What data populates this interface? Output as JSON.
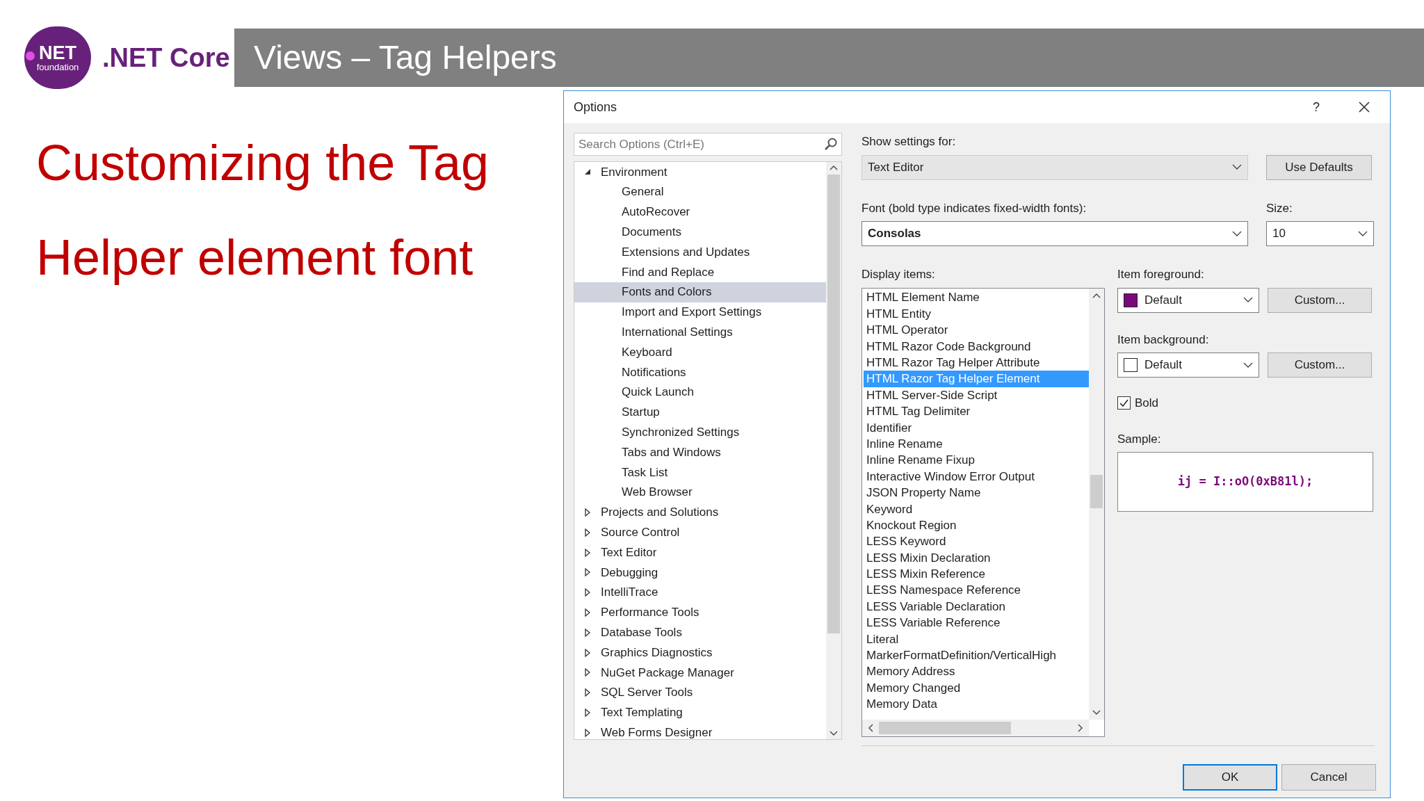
{
  "header": {
    "logo_top": "NET",
    "logo_bottom": "foundation",
    "brand": ".NET Core",
    "title": "Views – Tag Helpers"
  },
  "heading_lines": [
    "Customizing the Tag",
    "Helper element font"
  ],
  "dialog": {
    "title": "Options",
    "help": "?",
    "search": {
      "placeholder": "Search Options (Ctrl+E)"
    },
    "tree": [
      {
        "label": "Environment",
        "expanded": true,
        "children": [
          {
            "label": "General",
            "selected": false
          },
          {
            "label": "AutoRecover",
            "selected": false
          },
          {
            "label": "Documents",
            "selected": false
          },
          {
            "label": "Extensions and Updates",
            "selected": false
          },
          {
            "label": "Find and Replace",
            "selected": false
          },
          {
            "label": "Fonts and Colors",
            "selected": true
          },
          {
            "label": "Import and Export Settings",
            "selected": false
          },
          {
            "label": "International Settings",
            "selected": false
          },
          {
            "label": "Keyboard",
            "selected": false
          },
          {
            "label": "Notifications",
            "selected": false
          },
          {
            "label": "Quick Launch",
            "selected": false
          },
          {
            "label": "Startup",
            "selected": false
          },
          {
            "label": "Synchronized Settings",
            "selected": false
          },
          {
            "label": "Tabs and Windows",
            "selected": false
          },
          {
            "label": "Task List",
            "selected": false
          },
          {
            "label": "Web Browser",
            "selected": false
          }
        ]
      },
      {
        "label": "Projects and Solutions",
        "expanded": false
      },
      {
        "label": "Source Control",
        "expanded": false
      },
      {
        "label": "Text Editor",
        "expanded": false
      },
      {
        "label": "Debugging",
        "expanded": false
      },
      {
        "label": "IntelliTrace",
        "expanded": false
      },
      {
        "label": "Performance Tools",
        "expanded": false
      },
      {
        "label": "Database Tools",
        "expanded": false
      },
      {
        "label": "Graphics Diagnostics",
        "expanded": false
      },
      {
        "label": "NuGet Package Manager",
        "expanded": false
      },
      {
        "label": "SQL Server Tools",
        "expanded": false
      },
      {
        "label": "Text Templating",
        "expanded": false
      },
      {
        "label": "Web Forms Designer",
        "expanded": false
      }
    ],
    "show_settings_for": {
      "label": "Show settings for:",
      "value": "Text Editor"
    },
    "use_defaults": "Use Defaults",
    "font": {
      "label": "Font (bold type indicates fixed-width fonts):",
      "value": "Consolas"
    },
    "size": {
      "label": "Size:",
      "value": "10"
    },
    "display_items": {
      "label": "Display items:",
      "items": [
        {
          "label": "HTML Element Name",
          "selected": false
        },
        {
          "label": "HTML Entity",
          "selected": false
        },
        {
          "label": "HTML Operator",
          "selected": false
        },
        {
          "label": "HTML Razor Code Background",
          "selected": false
        },
        {
          "label": "HTML Razor Tag Helper Attribute",
          "selected": false
        },
        {
          "label": "HTML Razor Tag Helper Element",
          "selected": true
        },
        {
          "label": "HTML Server-Side Script",
          "selected": false
        },
        {
          "label": "HTML Tag Delimiter",
          "selected": false
        },
        {
          "label": "Identifier",
          "selected": false
        },
        {
          "label": "Inline Rename",
          "selected": false
        },
        {
          "label": "Inline Rename Fixup",
          "selected": false
        },
        {
          "label": "Interactive Window Error Output",
          "selected": false
        },
        {
          "label": "JSON Property Name",
          "selected": false
        },
        {
          "label": "Keyword",
          "selected": false
        },
        {
          "label": "Knockout Region",
          "selected": false
        },
        {
          "label": "LESS Keyword",
          "selected": false
        },
        {
          "label": "LESS Mixin Declaration",
          "selected": false
        },
        {
          "label": "LESS Mixin Reference",
          "selected": false
        },
        {
          "label": "LESS Namespace Reference",
          "selected": false
        },
        {
          "label": "LESS Variable Declaration",
          "selected": false
        },
        {
          "label": "LESS Variable Reference",
          "selected": false
        },
        {
          "label": "Literal",
          "selected": false
        },
        {
          "label": "MarkerFormatDefinition/VerticalHigh",
          "selected": false
        },
        {
          "label": "Memory Address",
          "selected": false
        },
        {
          "label": "Memory Changed",
          "selected": false
        },
        {
          "label": "Memory Data",
          "selected": false
        }
      ]
    },
    "item_foreground": {
      "label": "Item foreground:",
      "value": "Default",
      "color": "#7a0a7a",
      "button": "Custom..."
    },
    "item_background": {
      "label": "Item background:",
      "value": "Default",
      "color": "#ffffff",
      "button": "Custom..."
    },
    "bold": {
      "label": "Bold",
      "checked": true
    },
    "sample": {
      "label": "Sample:",
      "text": "ij = I::oO(0xB81l);"
    },
    "buttons": [
      "OK",
      "Cancel"
    ]
  }
}
